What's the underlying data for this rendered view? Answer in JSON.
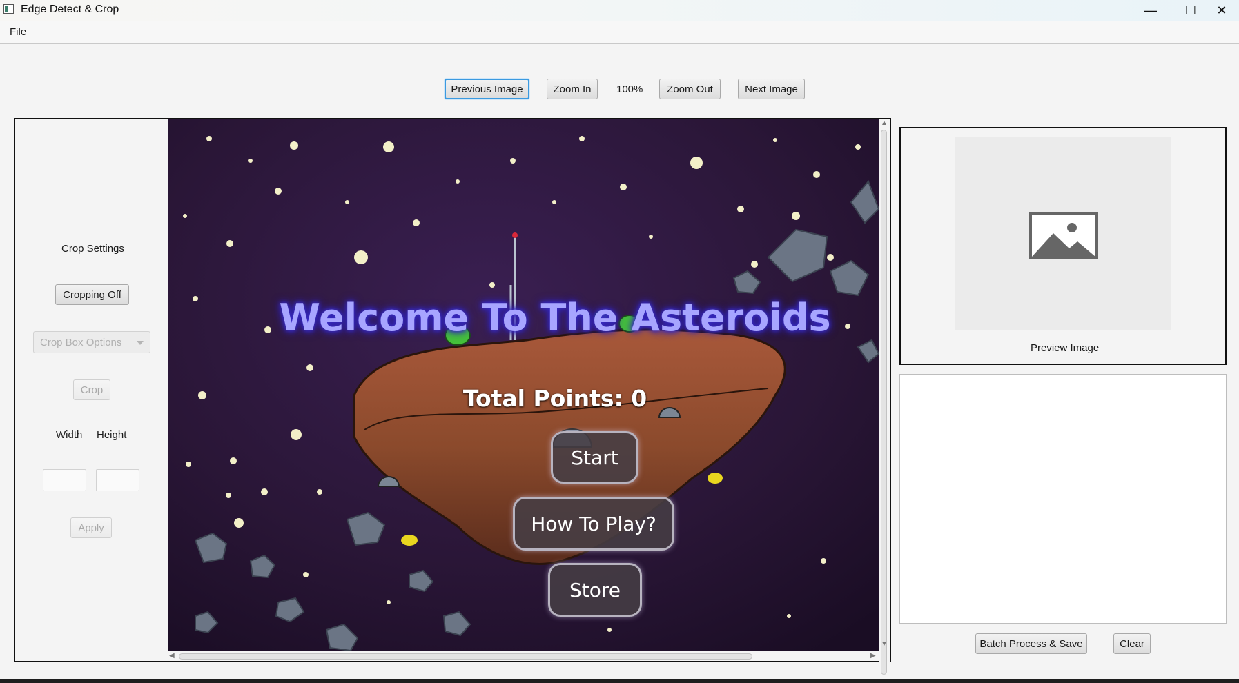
{
  "window": {
    "title": "Edge Detect & Crop",
    "controls": {
      "minimize": "—",
      "maximize": "☐",
      "close": "✕"
    }
  },
  "menubar": {
    "file": "File"
  },
  "toolbar": {
    "previous": "Previous Image",
    "zoom_in": "Zoom In",
    "zoom_level": "100%",
    "zoom_out": "Zoom Out",
    "next": "Next Image"
  },
  "crop_panel": {
    "heading": "Crop Settings",
    "toggle": "Cropping Off",
    "options_placeholder": "Crop Box Options",
    "crop": "Crop",
    "width_label": "Width",
    "height_label": "Height",
    "width_value": "",
    "height_value": "",
    "apply": "Apply"
  },
  "image_content": {
    "title": "Welcome To The Asteroids",
    "points": "Total Points: 0",
    "start": "Start",
    "how_to_play": "How To Play?",
    "store": "Store"
  },
  "preview": {
    "label": "Preview Image",
    "icon": "image-placeholder-icon"
  },
  "actions": {
    "batch": "Batch Process & Save",
    "clear": "Clear"
  },
  "colors": {
    "space": "#2a1637",
    "asteroid": "#8f4a2b",
    "focus": "#3b9ae0",
    "title_glow": "#3d30c9"
  }
}
